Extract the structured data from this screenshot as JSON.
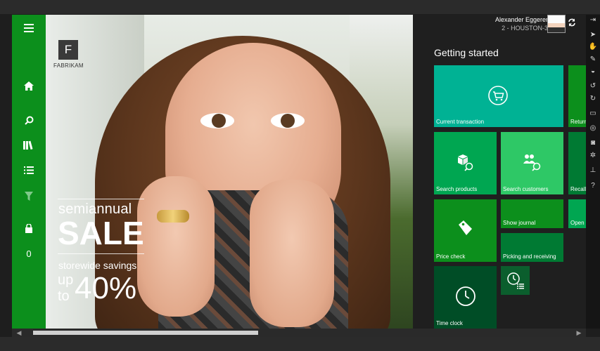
{
  "nav": {
    "items": [
      {
        "name": "menu-icon"
      },
      {
        "name": "home-icon"
      },
      {
        "name": "search-icon"
      },
      {
        "name": "products-icon"
      },
      {
        "name": "list-icon"
      },
      {
        "name": "filter-icon"
      },
      {
        "name": "cart-icon"
      }
    ],
    "cart_count": "0"
  },
  "hero": {
    "logo_letter": "F",
    "brand": "FABRIKAM",
    "promo": {
      "line1": "semiannual",
      "line2": "SALE",
      "line3": "storewide savings",
      "up": "up",
      "to": "to",
      "percent": "40%"
    }
  },
  "user": {
    "name": "Alexander Eggerer",
    "store": "2 - HOUSTON-3"
  },
  "getting_started": {
    "title": "Getting started",
    "tiles": {
      "current_transaction": "Current transaction",
      "returns": "Return",
      "search_products": "Search products",
      "search_customers": "Search customers",
      "recall": "Recall",
      "show_journal": "Show journal",
      "open": "Open",
      "price_check": "Price check",
      "picking_receiving": "Picking and receiving",
      "time_clock": "Time clock"
    }
  },
  "colors": {
    "nav_green": "#0c8f1c",
    "teal": "#00b294",
    "mid_green": "#00a651",
    "light_green": "#2ec866",
    "dark_green": "#007a33"
  }
}
